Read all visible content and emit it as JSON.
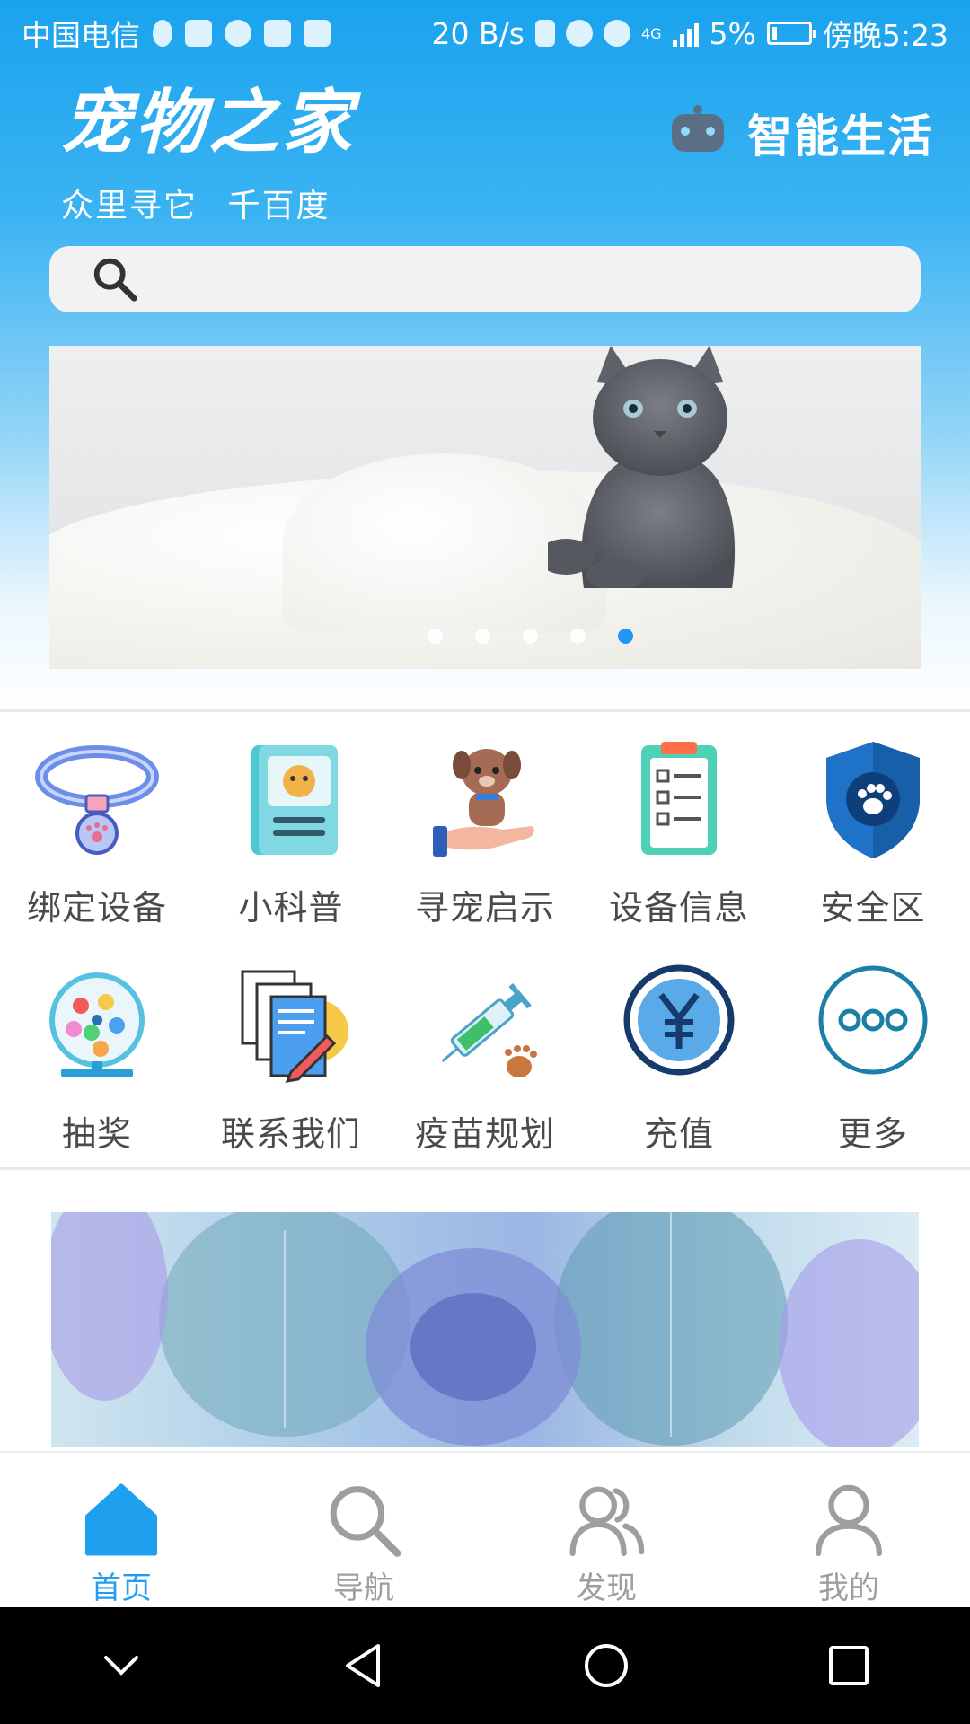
{
  "status_bar": {
    "carrier": "中国电信",
    "speed": "20 B/s",
    "network": "4G",
    "battery": "5%",
    "time": "傍晚5:23"
  },
  "header": {
    "app_title": "宠物之家",
    "subtitle": "众里寻它  千百度",
    "smart_label": "智能生活"
  },
  "search": {
    "placeholder": ""
  },
  "banner": {
    "slide_count": 5,
    "active_slide": 5
  },
  "grid": {
    "row1": [
      {
        "label": "绑定设备",
        "icon": "collar-icon"
      },
      {
        "label": "小科普",
        "icon": "book-icon"
      },
      {
        "label": "寻宠启示",
        "icon": "dog-in-hand-icon"
      },
      {
        "label": "设备信息",
        "icon": "clipboard-icon"
      },
      {
        "label": "安全区",
        "icon": "shield-paw-icon"
      }
    ],
    "row2": [
      {
        "label": "抽奖",
        "icon": "lottery-icon"
      },
      {
        "label": "联系我们",
        "icon": "documents-icon"
      },
      {
        "label": "疫苗规划",
        "icon": "syringe-icon"
      },
      {
        "label": "充值",
        "icon": "yuan-coin-icon"
      },
      {
        "label": "更多",
        "icon": "more-icon"
      }
    ]
  },
  "tabs": [
    {
      "label": "首页",
      "icon": "home-icon",
      "active": true
    },
    {
      "label": "导航",
      "icon": "search-icon",
      "active": false
    },
    {
      "label": "发现",
      "icon": "people-icon",
      "active": false
    },
    {
      "label": "我的",
      "icon": "person-icon",
      "active": false
    }
  ],
  "colors": {
    "accent": "#1ea0ee",
    "inactive": "#9e9e9e",
    "dot_active": "#2196f3"
  }
}
